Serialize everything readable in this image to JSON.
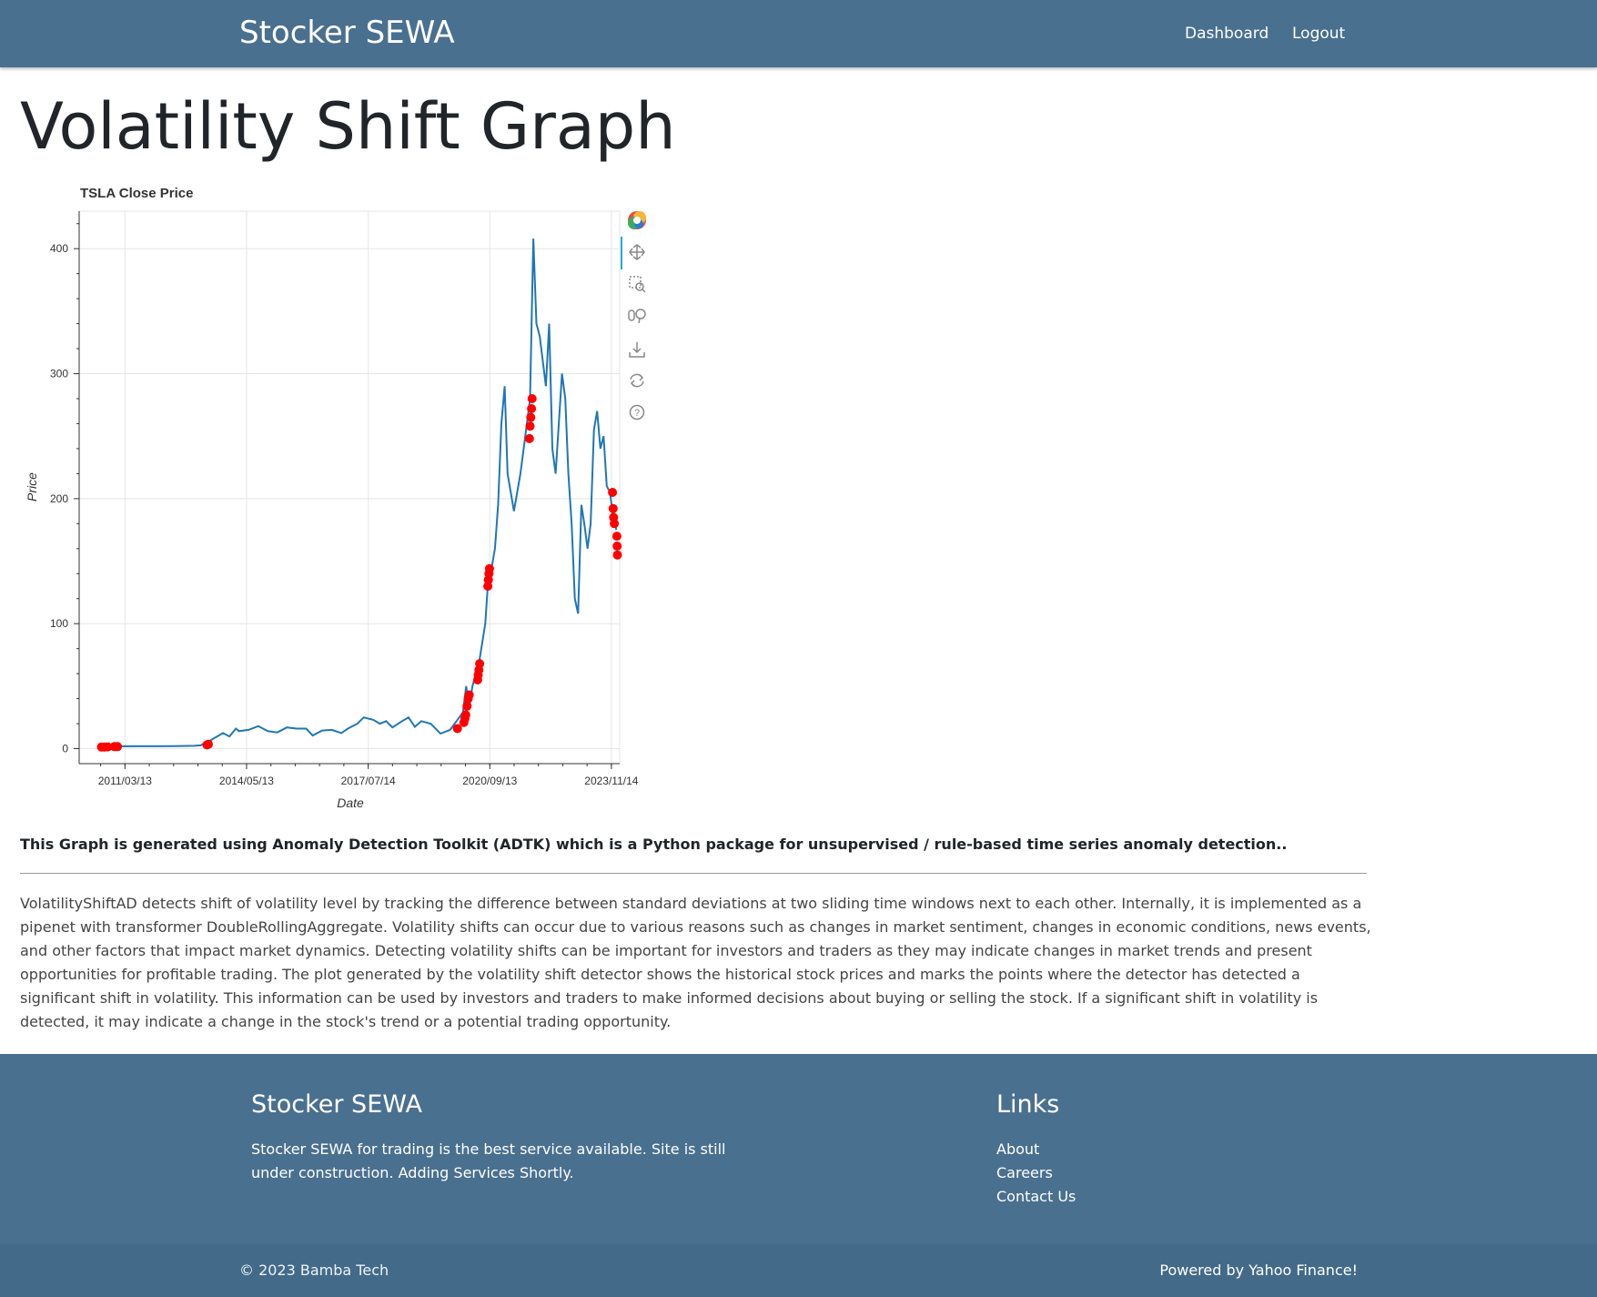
{
  "navbar": {
    "brand": "Stocker SEWA",
    "links": [
      "Dashboard",
      "Logout"
    ]
  },
  "page": {
    "title": "Volatility Shift Graph"
  },
  "chart_data": {
    "type": "line",
    "title": "TSLA Close Price",
    "xlabel": "Date",
    "ylabel": "Price",
    "x_ticks": [
      "2011/03/13",
      "2014/05/13",
      "2017/07/14",
      "2020/09/13",
      "2023/11/14"
    ],
    "y_ticks": [
      0,
      100,
      200,
      300,
      400
    ],
    "xlim": [
      "2010/01/01",
      "2024/02/01"
    ],
    "ylim": [
      -12,
      430
    ],
    "grid": true,
    "colors": {
      "line": "#1f77b4",
      "anomaly": "#ff0000"
    },
    "series": [
      {
        "values": [
          [
            "2010/07/01",
            1.3
          ],
          [
            "2011/01/01",
            1.8
          ],
          [
            "2011/07/01",
            1.9
          ],
          [
            "2012/01/01",
            1.9
          ],
          [
            "2012/07/01",
            2.0
          ],
          [
            "2013/01/01",
            2.3
          ],
          [
            "2013/03/01",
            2.6
          ],
          [
            "2013/06/01",
            6.5
          ],
          [
            "2013/09/01",
            11
          ],
          [
            "2013/10/01",
            12.5
          ],
          [
            "2013/12/01",
            9.8
          ],
          [
            "2014/02/01",
            16
          ],
          [
            "2014/03/01",
            14
          ],
          [
            "2014/06/01",
            15
          ],
          [
            "2014/09/01",
            18
          ],
          [
            "2014/12/01",
            14
          ],
          [
            "2015/03/01",
            13
          ],
          [
            "2015/06/01",
            17
          ],
          [
            "2015/09/01",
            16
          ],
          [
            "2015/12/01",
            16
          ],
          [
            "2016/02/01",
            10.5
          ],
          [
            "2016/05/01",
            14.5
          ],
          [
            "2016/08/01",
            15
          ],
          [
            "2016/11/01",
            12.5
          ],
          [
            "2017/01/01",
            16
          ],
          [
            "2017/04/01",
            20
          ],
          [
            "2017/06/01",
            25
          ],
          [
            "2017/09/01",
            23
          ],
          [
            "2017/11/01",
            20
          ],
          [
            "2018/01/01",
            22
          ],
          [
            "2018/03/01",
            17
          ],
          [
            "2018/06/01",
            22
          ],
          [
            "2018/08/01",
            25
          ],
          [
            "2018/10/01",
            17.5
          ],
          [
            "2018/12/01",
            22
          ],
          [
            "2019/03/01",
            20
          ],
          [
            "2019/06/01",
            12
          ],
          [
            "2019/09/01",
            15
          ],
          [
            "2019/11/01",
            22
          ],
          [
            "2020/01/01",
            29
          ],
          [
            "2020/02/01",
            50
          ],
          [
            "2020/03/01",
            33
          ],
          [
            "2020/04/01",
            50
          ],
          [
            "2020/06/01",
            68
          ],
          [
            "2020/08/01",
            100
          ],
          [
            "2020/09/01",
            140
          ],
          [
            "2020/10/01",
            145
          ],
          [
            "2020/11/01",
            160
          ],
          [
            "2020/12/01",
            195
          ],
          [
            "2021/01/01",
            260
          ],
          [
            "2021/02/01",
            290
          ],
          [
            "2021/03/01",
            220
          ],
          [
            "2021/05/01",
            190
          ],
          [
            "2021/07/01",
            220
          ],
          [
            "2021/08/01",
            240
          ],
          [
            "2021/10/01",
            280
          ],
          [
            "2021/11/01",
            408
          ],
          [
            "2021/12/01",
            340
          ],
          [
            "2022/01/01",
            330
          ],
          [
            "2022/03/01",
            290
          ],
          [
            "2022/04/01",
            340
          ],
          [
            "2022/05/01",
            240
          ],
          [
            "2022/06/01",
            220
          ],
          [
            "2022/08/01",
            300
          ],
          [
            "2022/09/01",
            280
          ],
          [
            "2022/10/01",
            220
          ],
          [
            "2022/11/01",
            180
          ],
          [
            "2022/12/01",
            120
          ],
          [
            "2023/01/01",
            108
          ],
          [
            "2023/02/01",
            195
          ],
          [
            "2023/03/01",
            180
          ],
          [
            "2023/04/01",
            160
          ],
          [
            "2023/05/01",
            180
          ],
          [
            "2023/06/01",
            255
          ],
          [
            "2023/07/01",
            270
          ],
          [
            "2023/08/01",
            240
          ],
          [
            "2023/09/01",
            250
          ],
          [
            "2023/10/01",
            210
          ],
          [
            "2023/11/01",
            205
          ],
          [
            "2023/12/01",
            185
          ],
          [
            "2024/01/01",
            175
          ]
        ]
      }
    ],
    "anomalies": [
      [
        "2010/08/01",
        1.3
      ],
      [
        "2010/09/01",
        1.3
      ],
      [
        "2010/10/01",
        1.4
      ],
      [
        "2010/12/01",
        1.6
      ],
      [
        "2011/01/01",
        1.6
      ],
      [
        "2013/05/01",
        3.0
      ],
      [
        "2013/05/15",
        3.5
      ],
      [
        "2019/11/10",
        16
      ],
      [
        "2020/01/10",
        21
      ],
      [
        "2020/01/20",
        24
      ],
      [
        "2020/01/28",
        27
      ],
      [
        "2020/02/10",
        34
      ],
      [
        "2020/02/20",
        40
      ],
      [
        "2020/03/01",
        43
      ],
      [
        "2020/05/20",
        55
      ],
      [
        "2020/05/25",
        59
      ],
      [
        "2020/06/01",
        63
      ],
      [
        "2020/06/08",
        68
      ],
      [
        "2020/08/25",
        130
      ],
      [
        "2020/08/30",
        135
      ],
      [
        "2020/09/05",
        140
      ],
      [
        "2020/09/10",
        144
      ],
      [
        "2021/09/25",
        248
      ],
      [
        "2021/10/01",
        258
      ],
      [
        "2021/10/08",
        265
      ],
      [
        "2021/10/15",
        272
      ],
      [
        "2021/10/20",
        280
      ],
      [
        "2023/11/25",
        205
      ],
      [
        "2023/12/01",
        192
      ],
      [
        "2023/12/05",
        185
      ],
      [
        "2023/12/12",
        180
      ],
      [
        "2024/01/05",
        170
      ],
      [
        "2024/01/08",
        162
      ],
      [
        "2024/01/10",
        155
      ]
    ]
  },
  "toolbar": {
    "tools": [
      "bokeh-logo-icon",
      "pan-icon",
      "box-zoom-icon",
      "wheel-zoom-icon",
      "save-icon",
      "reset-icon",
      "help-icon"
    ]
  },
  "content": {
    "note": "This Graph is generated using Anomaly Detection Toolkit (ADTK) which is a Python package for unsupervised / rule-based time series anomaly detection..",
    "description": "VolatilityShiftAD detects shift of volatility level by tracking the difference between standard deviations at two sliding time windows next to each other. Internally, it is implemented as a pipenet with transformer DoubleRollingAggregate. Volatility shifts can occur due to various reasons such as changes in market sentiment, changes in economic conditions, news events, and other factors that impact market dynamics. Detecting volatility shifts can be important for investors and traders as they may indicate changes in market trends and present opportunities for profitable trading. The plot generated by the volatility shift detector shows the historical stock prices and marks the points where the detector has detected a significant shift in volatility. This information can be used by investors and traders to make informed decisions about buying or selling the stock. If a significant shift in volatility is detected, it may indicate a change in the stock's trend or a potential trading opportunity."
  },
  "footer": {
    "brand": "Stocker SEWA",
    "text": "Stocker SEWA for trading is the best service available. Site is still under construction. Adding Services Shortly.",
    "links_title": "Links",
    "links": [
      "About",
      "Careers",
      "Contact Us"
    ],
    "copyright": "© 2023 Bamba Tech",
    "powered": "Powered by Yahoo Finance!"
  }
}
